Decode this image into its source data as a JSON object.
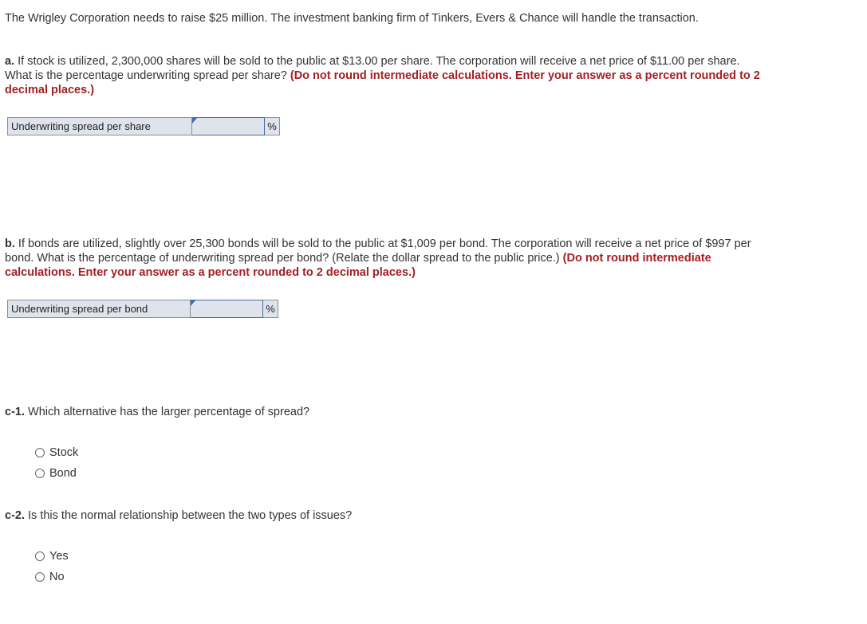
{
  "intro": "The Wrigley Corporation needs to raise $25 million. The investment banking firm of Tinkers, Evers & Chance will handle the transaction.",
  "part_a": {
    "prefix": "a.",
    "text": " If stock is utilized, 2,300,000 shares will be sold to the public at $13.00 per share. The corporation will receive a net price of $11.00 per share. What is the percentage underwriting spread per share? ",
    "instruction": "(Do not round intermediate calculations. Enter your answer as a percent rounded to 2 decimal places.)",
    "answer_label": "Underwriting spread per share",
    "answer_value": "",
    "unit": "%"
  },
  "part_b": {
    "prefix": "b.",
    "text": " If bonds are utilized, slightly over 25,300 bonds will be sold to the public at $1,009 per bond. The corporation will receive a net price of $997 per bond. What is the percentage of underwriting spread per bond? (Relate the dollar spread to the public price.) ",
    "instruction": "(Do not round intermediate calculations. Enter your answer as a percent rounded to 2 decimal places.)",
    "answer_label": "Underwriting spread per bond",
    "answer_value": "",
    "unit": "%"
  },
  "part_c1": {
    "prefix": "c-1.",
    "text": " Which alternative has the larger percentage of spread?",
    "options": [
      "Stock",
      "Bond"
    ]
  },
  "part_c2": {
    "prefix": "c-2.",
    "text": " Is this the normal relationship between the two types of issues?",
    "options": [
      "Yes",
      "No"
    ]
  }
}
